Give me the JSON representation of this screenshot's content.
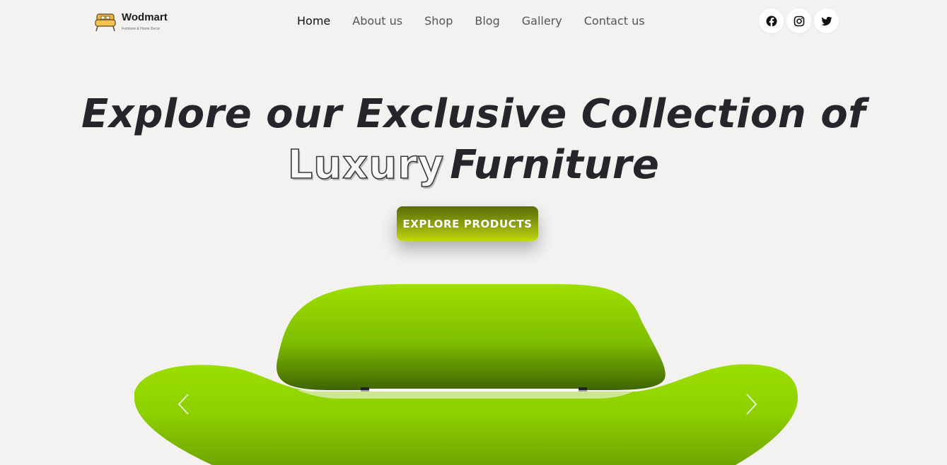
{
  "brand": {
    "name": "Wodmart",
    "tagline": "Furniture & Home Decor"
  },
  "nav": {
    "items": [
      {
        "label": "Home",
        "active": true
      },
      {
        "label": "About us",
        "active": false
      },
      {
        "label": "Shop",
        "active": false
      },
      {
        "label": "Blog",
        "active": false
      },
      {
        "label": "Gallery",
        "active": false
      },
      {
        "label": "Contact us",
        "active": false
      }
    ]
  },
  "social": {
    "icons": [
      "facebook-icon",
      "instagram-icon",
      "twitter-icon"
    ]
  },
  "hero": {
    "title_line1": "Explore our Exclusive Collection of",
    "title_highlight": "Luxury",
    "title_line2_rest": "Furniture",
    "cta_label": "EXPLORE PRODUCTS"
  },
  "carousel": {
    "prev_icon": "chevron-left-icon",
    "next_icon": "chevron-right-icon"
  },
  "colors": {
    "background": "#f3f2f0",
    "heading": "#24262b",
    "accent": "#93a80e",
    "sofa": "#8fd100"
  }
}
